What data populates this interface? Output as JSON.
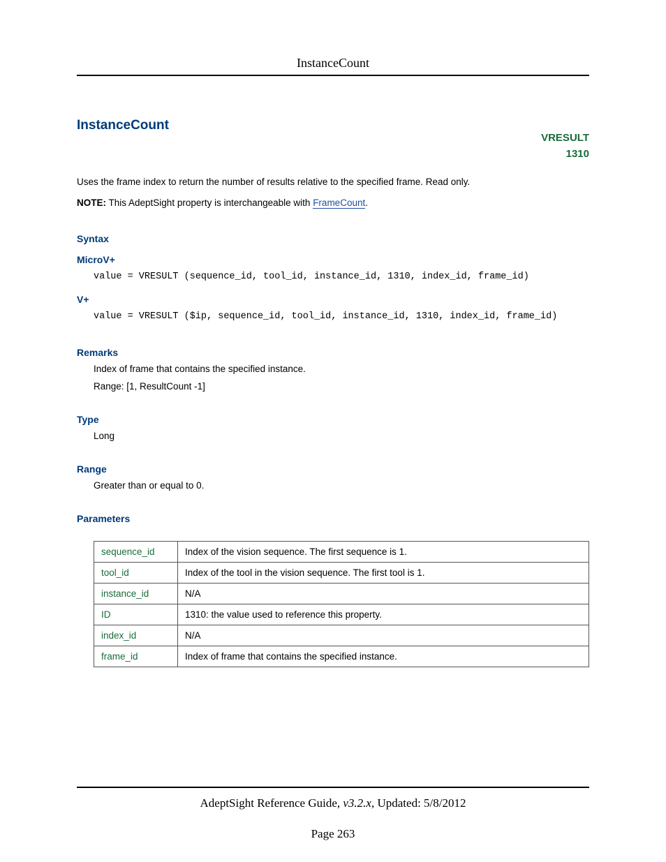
{
  "header": {
    "title": "InstanceCount"
  },
  "title": "InstanceCount",
  "vresult": {
    "label": "VRESULT",
    "code": "1310"
  },
  "intro": {
    "description": "Uses the frame index to return the number of results relative to the specified frame. Read only.",
    "note_label": "NOTE:",
    "note_text_before": " This AdeptSight property is interchangeable with ",
    "note_link": "FrameCount",
    "note_text_after": "."
  },
  "syntax": {
    "heading": "Syntax",
    "microv_label": "MicroV+",
    "microv_code": "value = VRESULT (sequence_id, tool_id, instance_id, 1310, index_id, frame_id)",
    "vplus_label": "V+",
    "vplus_code": "value = VRESULT ($ip, sequence_id, tool_id, instance_id, 1310, index_id, frame_id)"
  },
  "remarks": {
    "heading": "Remarks",
    "line1": "Index of frame that contains the specified instance.",
    "line2": "Range: [1, ResultCount -1]"
  },
  "type": {
    "heading": "Type",
    "value": "Long"
  },
  "range": {
    "heading": "Range",
    "value": "Greater than or equal to 0."
  },
  "parameters": {
    "heading": "Parameters",
    "rows": [
      {
        "name": "sequence_id",
        "desc": "Index of the vision sequence. The first sequence is 1."
      },
      {
        "name": "tool_id",
        "desc": "Index of the tool in the vision sequence. The first tool is 1."
      },
      {
        "name": "instance_id",
        "desc": "N/A"
      },
      {
        "name": "ID",
        "desc": "1310: the value used to reference this property."
      },
      {
        "name": "index_id",
        "desc": "N/A"
      },
      {
        "name": "frame_id",
        "desc": "Index of frame that contains the specified instance."
      }
    ]
  },
  "footer": {
    "guide": "AdeptSight Reference Guide",
    "version": ", v3.2.x",
    "updated": ", Updated: 5/8/2012",
    "page": "Page 263"
  }
}
